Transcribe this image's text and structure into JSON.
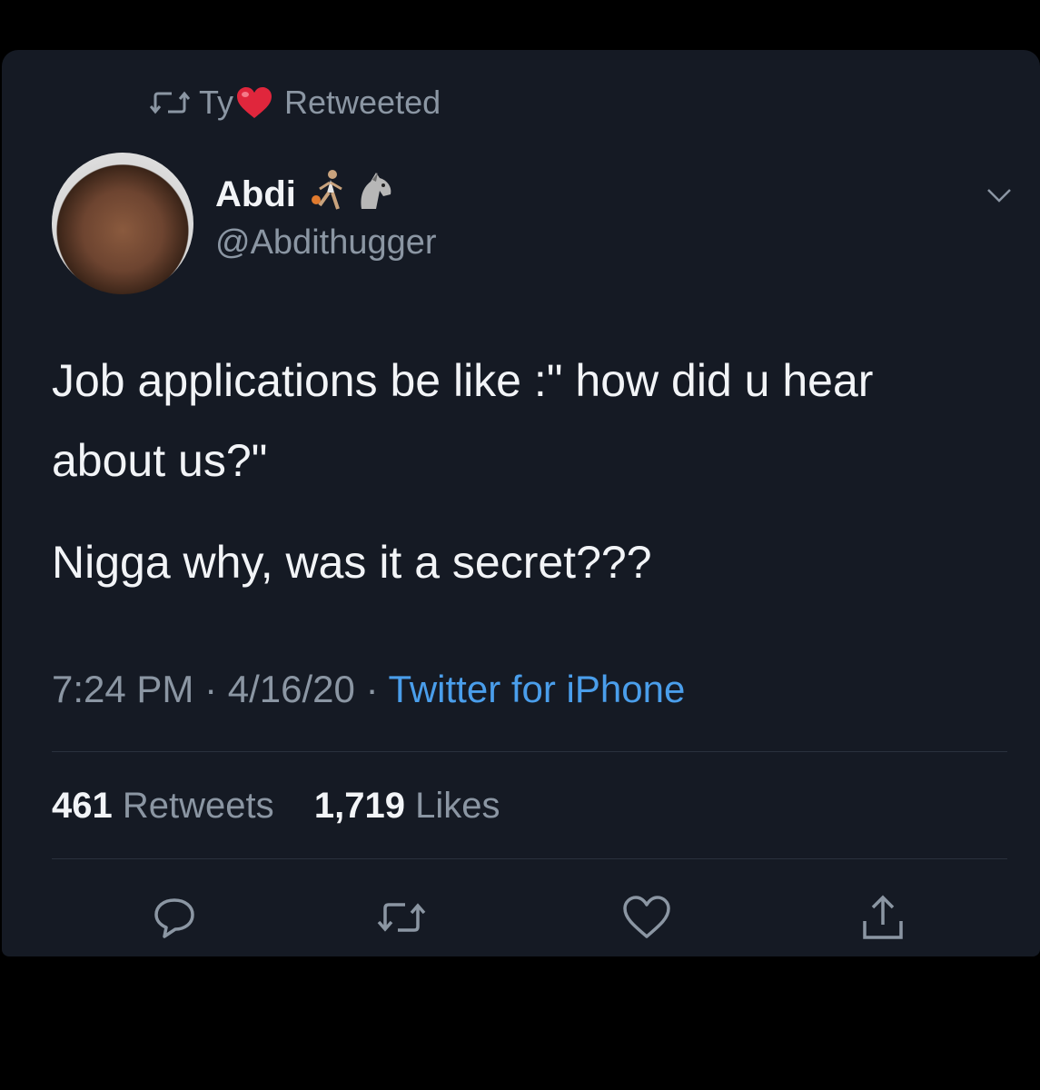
{
  "retweet_header": {
    "name": "Ty",
    "suffix": "Retweeted"
  },
  "author": {
    "display_name": "Abdi",
    "handle": "@Abdithugger"
  },
  "tweet": {
    "lines": [
      "Job applications be like :\" how did u hear about us?\"",
      "Nigga why, was it a secret???"
    ]
  },
  "meta": {
    "time": "7:24 PM",
    "separator": "·",
    "date": "4/16/20",
    "source": "Twitter for iPhone"
  },
  "stats": {
    "retweets_count": "461",
    "retweets_label": "Retweets",
    "likes_count": "1,719",
    "likes_label": "Likes"
  },
  "icons": {
    "reply": "reply-icon",
    "retweet": "retweet-icon",
    "like": "heart-icon",
    "share": "share-icon",
    "menu": "chevron-down-icon"
  },
  "colors": {
    "background": "#151a24",
    "text_primary": "#f2f4f7",
    "text_secondary": "#8b96a3",
    "link": "#4a9eeb",
    "heart_emoji": "#e0263c"
  }
}
